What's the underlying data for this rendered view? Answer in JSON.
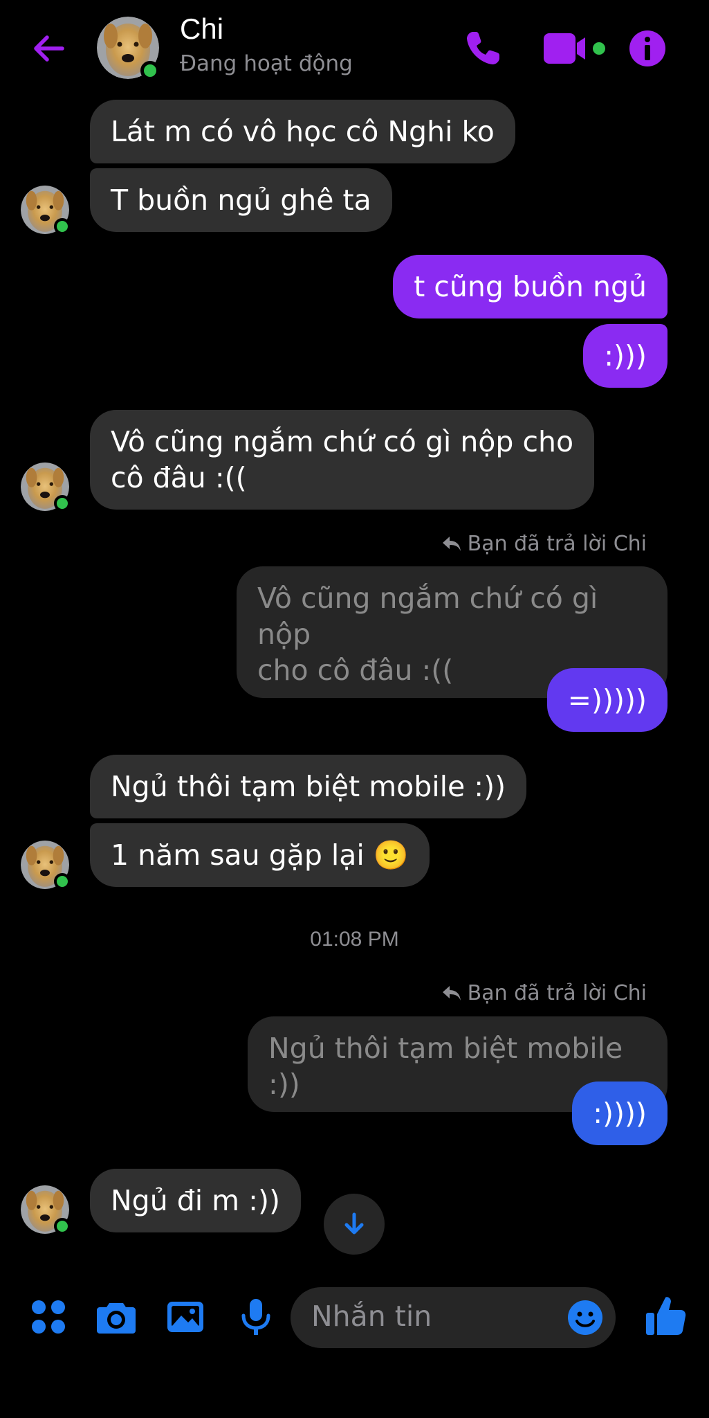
{
  "header": {
    "name": "Chi",
    "status": "Đang hoạt động"
  },
  "messages": {
    "m1": "Lát m có vô học cô Nghi ko",
    "m2": "T buồn ngủ ghê ta",
    "m3": "t cũng buồn ngủ",
    "m4": ":)))",
    "m5_line1": "Vô cũng ngắm chứ có gì nộp cho",
    "m5_line2": "cô đâu :((",
    "reply1_label": "Bạn đã trả lời Chi",
    "reply1_quote_line1": "Vô cũng ngắm chứ có gì nộp",
    "reply1_quote_line2": "cho cô đâu :((",
    "m6": "=)))))",
    "m7": "Ngủ thôi tạm biệt mobile :))",
    "m8": "1 năm sau gặp lại 🙂",
    "time": "01:08 PM",
    "reply2_label": "Bạn đã trả lời Chi",
    "reply2_quote": "Ngủ thôi tạm biệt mobile :))",
    "m9": ":))))",
    "m10": "Ngủ đi m :))"
  },
  "composer": {
    "placeholder": "Nhắn tin"
  },
  "colors": {
    "accent_purple": "#a020f0",
    "accent_blue": "#1e7bf2",
    "online_green": "#31c24d"
  },
  "icons": {
    "back": "arrow-left-icon",
    "call": "phone-icon",
    "video": "video-camera-icon",
    "info": "info-icon",
    "menu": "four-dots-icon",
    "camera": "camera-icon",
    "gallery": "image-icon",
    "mic": "microphone-icon",
    "emoji": "smiley-icon",
    "like": "thumbs-up-icon",
    "reply": "reply-arrow-icon",
    "scroll": "arrow-down-icon"
  }
}
